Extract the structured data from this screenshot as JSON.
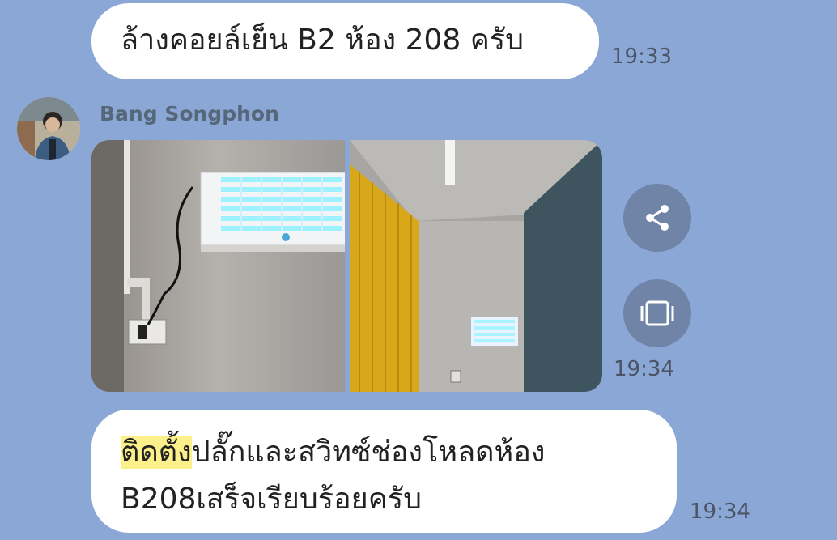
{
  "messages": [
    {
      "text": "ล้างคอยล์เย็น B2 ห้อง 208 ครับ",
      "time": "19:33"
    },
    {
      "sender": "Bang Songphon",
      "time": "19:34",
      "icons": [
        "share-icon",
        "expand-icon"
      ]
    },
    {
      "highlight": "ติดตั้ง",
      "text": "ปลั๊กและสวิทซ์ช่องโหลดห้อง B208เสร็จเรียบร้อยครับ",
      "time": "19:34"
    }
  ],
  "colors": {
    "background": "#8aa7d6",
    "bubble": "#ffffff",
    "highlight": "#fbf08a",
    "button": "#6f84a6"
  }
}
